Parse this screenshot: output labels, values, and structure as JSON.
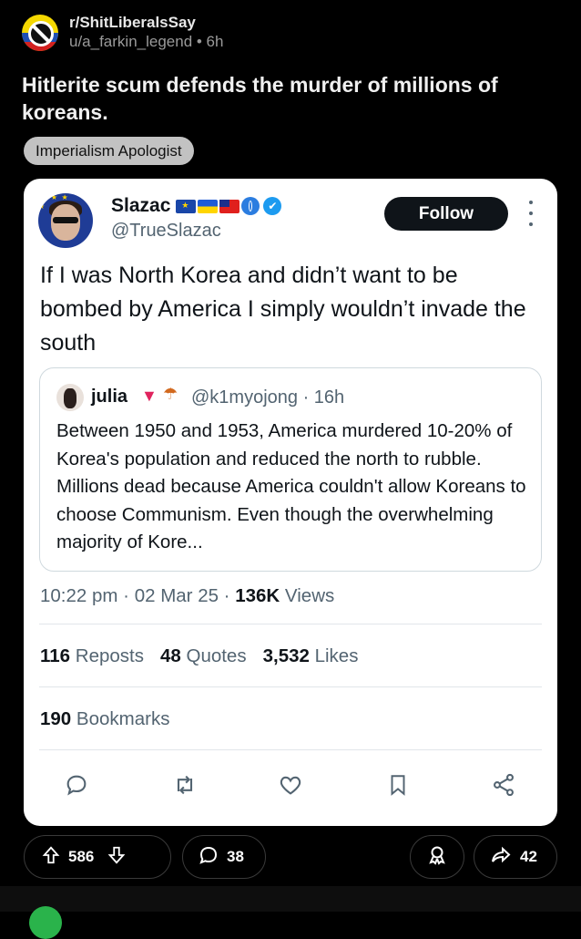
{
  "post": {
    "subreddit": "r/ShitLiberalsSay",
    "author_line": "u/a_farkin_legend • 6h",
    "title": "Hitlerite scum defends the murder of millions of koreans.",
    "flair": "Imperialism Apologist"
  },
  "tweet": {
    "display_name": "Slazac",
    "handle": "@TrueSlazac",
    "follow_label": "Follow",
    "text": "If I was North Korea and didn’t want to be bombed by America I simply wouldn’t invade the south",
    "quote": {
      "name": "julia",
      "meta": "@k1myojong · 16h",
      "text": "Between 1950 and 1953, America murdered 10-20% of Korea's population and reduced the north to rubble. Millions dead because America couldn't allow Koreans to choose Communism. Even though the overwhelming majority of Kore..."
    },
    "time": "10:22 pm · 02 Mar 25 · ",
    "views_count": "136K",
    "views_label": " Views",
    "stats": {
      "reposts_count": "116",
      "reposts_label": " Reposts",
      "quotes_count": "48",
      "quotes_label": " Quotes",
      "likes_count": "3,532",
      "likes_label": " Likes"
    },
    "bookmarks_count": "190",
    "bookmarks_label": " Bookmarks"
  },
  "bottom_bar": {
    "votes": "586",
    "comments": "38",
    "shares": "42"
  },
  "icons": [
    "subreddit-icon",
    "verified-icon",
    "more-icon",
    "reply-icon",
    "retweet-icon",
    "like-icon",
    "bookmark-icon",
    "share-icon",
    "upvote-icon",
    "downvote-icon",
    "comment-icon",
    "award-icon",
    "share-arrow-icon"
  ],
  "colors": {
    "accent_blue": "#1d9bf0",
    "muted": "#536471",
    "flair_bg": "#c2c2c2"
  }
}
